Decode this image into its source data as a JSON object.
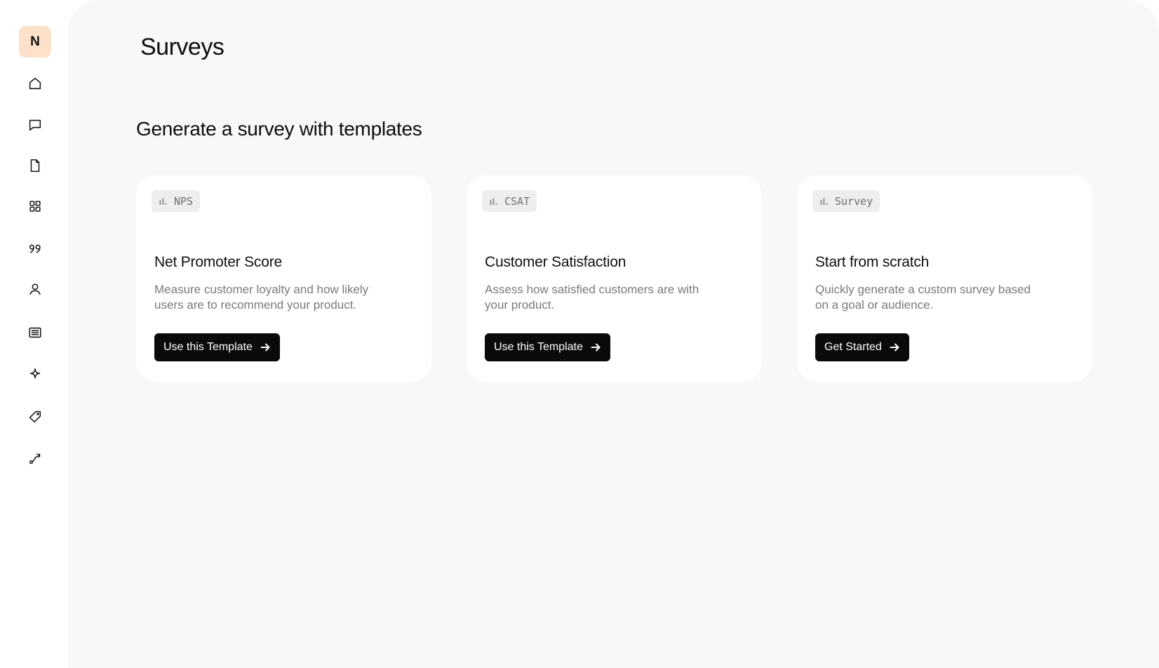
{
  "user": {
    "avatar_initial": "N"
  },
  "sidebar": {
    "items": [
      {
        "icon": "home-icon"
      },
      {
        "icon": "chat-icon"
      },
      {
        "icon": "document-icon"
      },
      {
        "icon": "grid-icon"
      },
      {
        "icon": "quote-icon"
      },
      {
        "icon": "user-icon"
      },
      {
        "icon": "list-icon"
      },
      {
        "icon": "sparkle-icon"
      },
      {
        "icon": "tag-icon"
      },
      {
        "icon": "route-icon"
      }
    ]
  },
  "header": {
    "title": "Surveys"
  },
  "templates_section": {
    "title": "Generate a survey with templates",
    "cards": [
      {
        "tag": "NPS",
        "title": "Net Promoter Score",
        "description": "Measure customer loyalty and how likely users are to recommend your product.",
        "button_label": "Use this Template"
      },
      {
        "tag": "CSAT",
        "title": "Customer Satisfaction",
        "description": "Assess how satisfied customers are with your product.",
        "button_label": "Use this Template"
      },
      {
        "tag": "Survey",
        "title": "Start from scratch",
        "description": "Quickly generate a custom survey based on a goal or audience.",
        "button_label": "Get Started"
      }
    ]
  },
  "colors": {
    "avatar_bg": "#fde1cb",
    "main_bg": "#f8f8f8",
    "button_bg": "#0a0a0a"
  }
}
